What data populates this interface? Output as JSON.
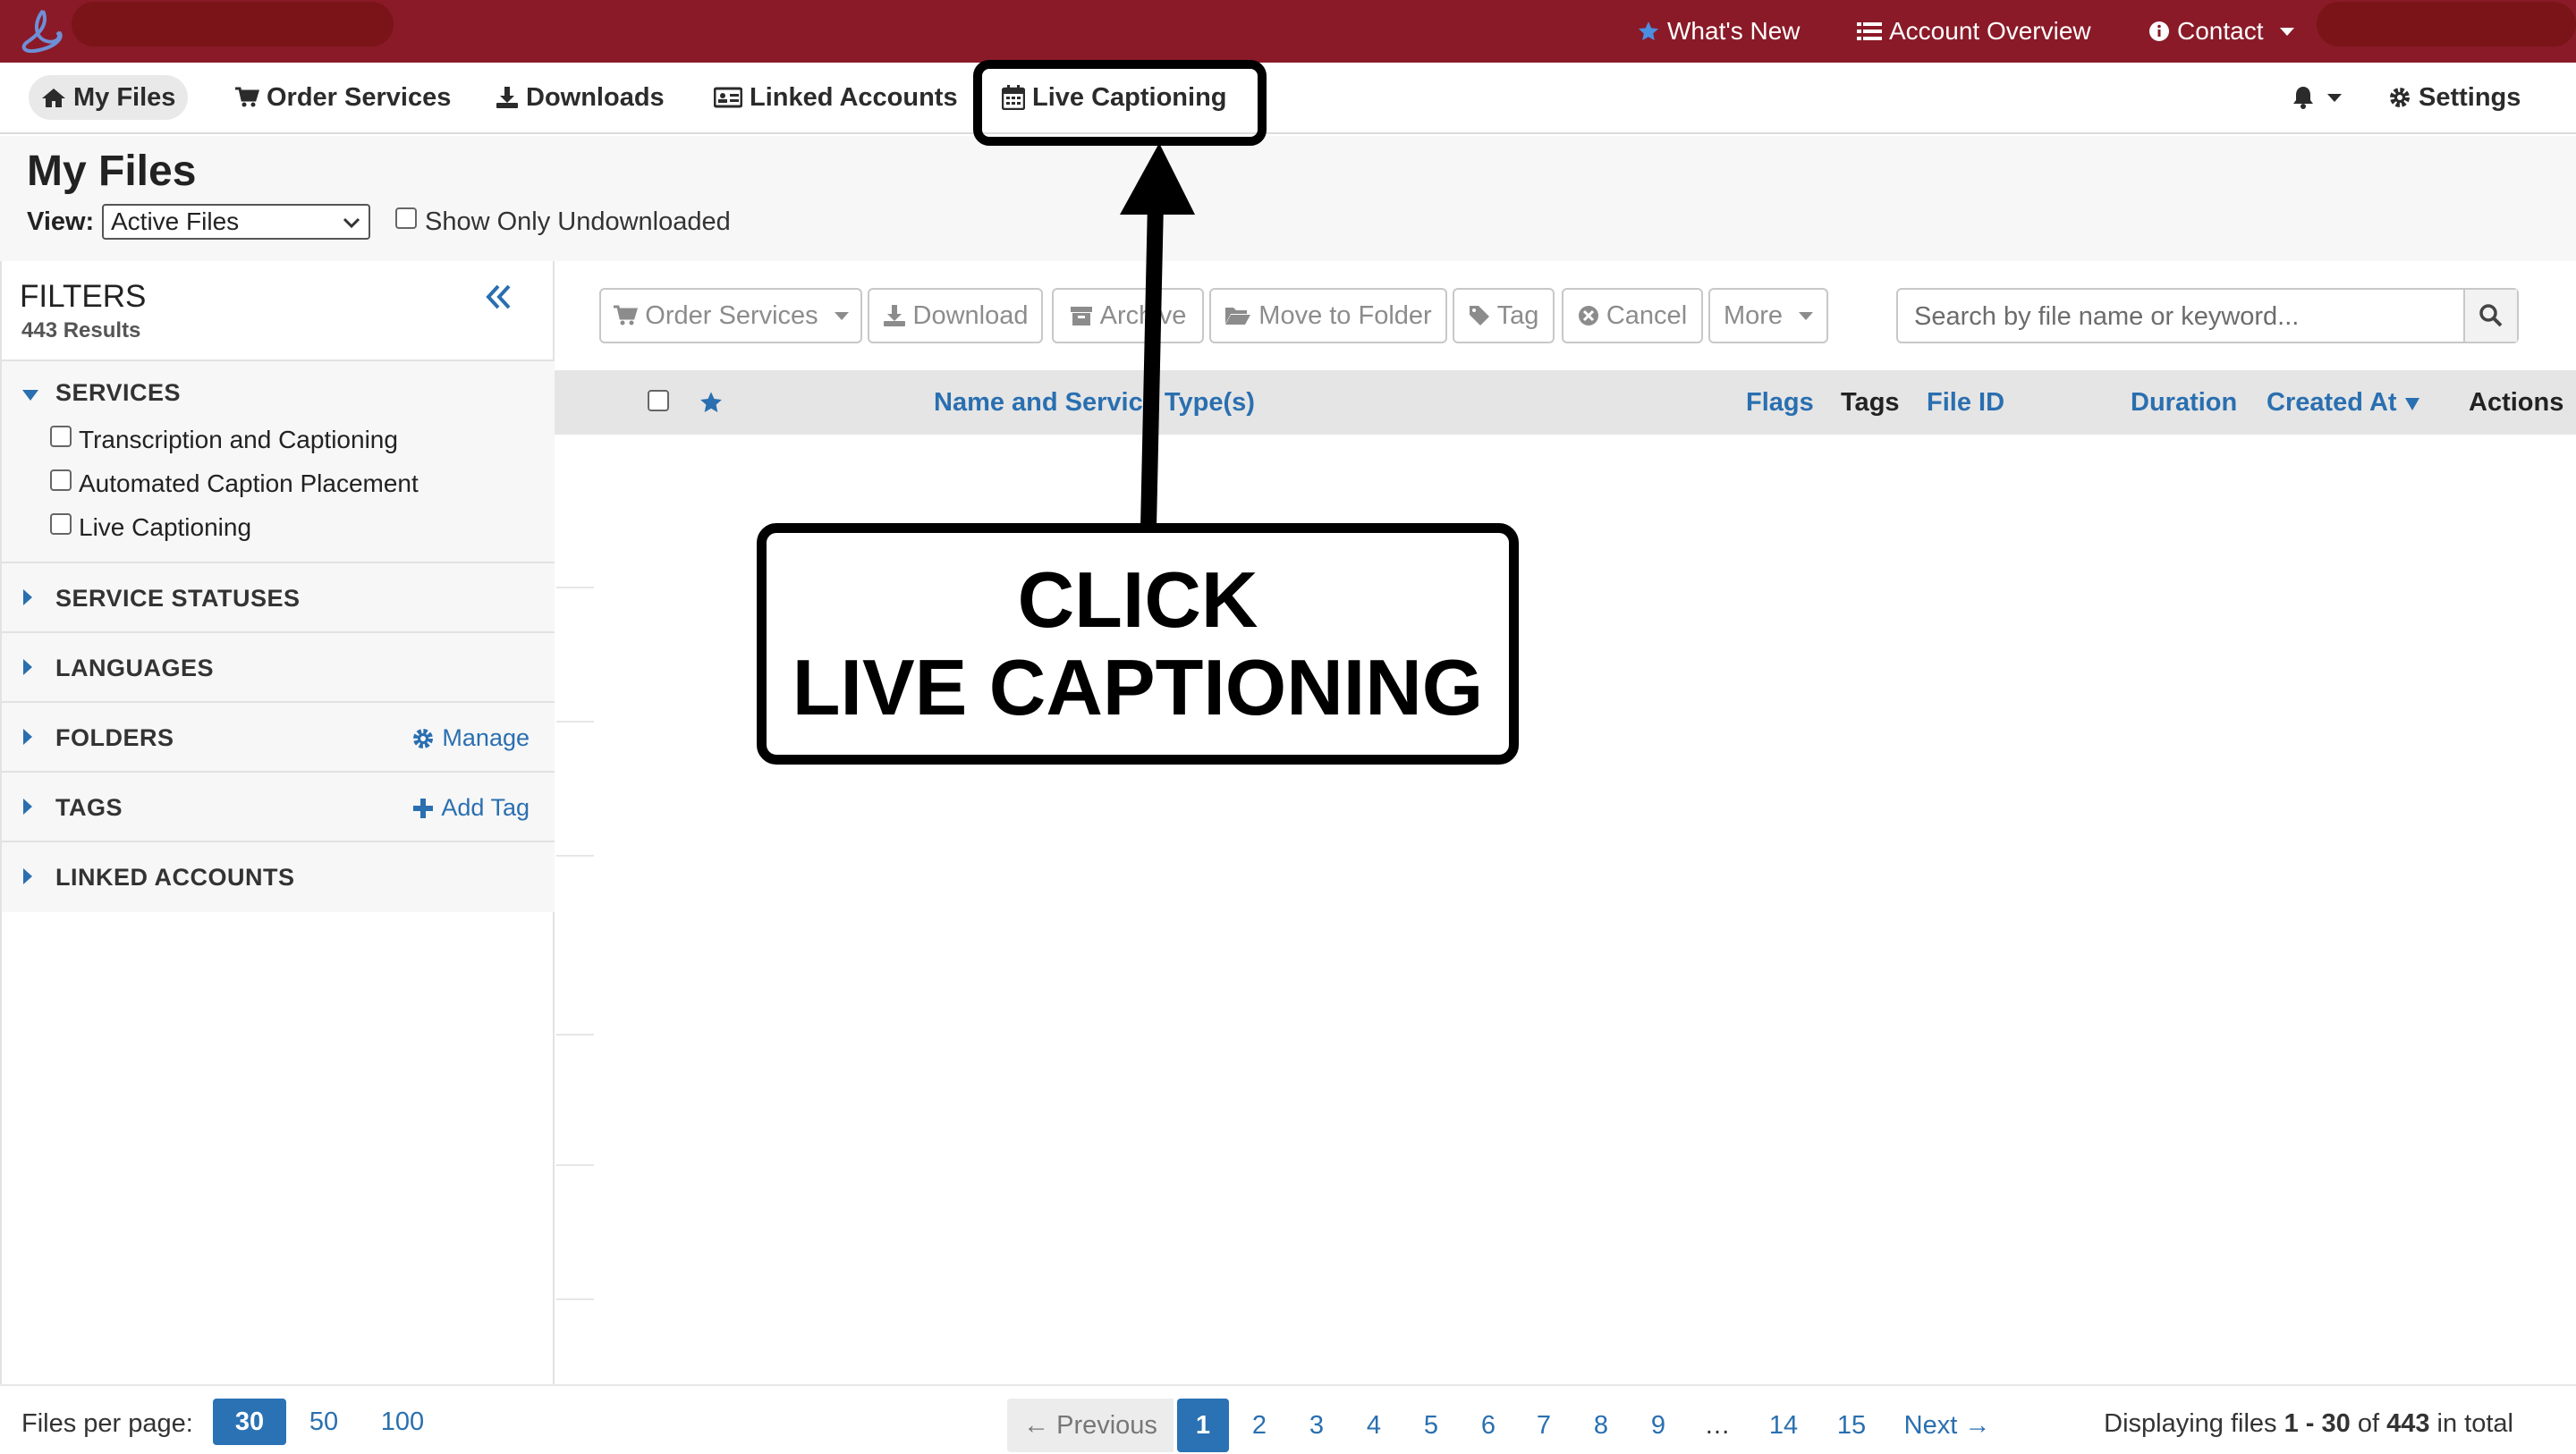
{
  "topbar": {
    "whats_new": "What's New",
    "account_overview": "Account Overview",
    "contact": "Contact"
  },
  "nav": {
    "my_files": "My Files",
    "order_services": "Order Services",
    "downloads": "Downloads",
    "linked_accounts": "Linked Accounts",
    "live_captioning": "Live Captioning",
    "settings": "Settings"
  },
  "page": {
    "title": "My Files",
    "view_label": "View:",
    "view_value": "Active Files",
    "show_only_undownloaded": "Show Only Undownloaded"
  },
  "filters": {
    "title": "FILTERS",
    "results": "443 Results",
    "services": {
      "title": "SERVICES",
      "options": [
        "Transcription and Captioning",
        "Automated Caption Placement",
        "Live Captioning"
      ]
    },
    "service_statuses": "SERVICE STATUSES",
    "languages": "LANGUAGES",
    "folders": "FOLDERS",
    "folders_action": "Manage",
    "tags": "TAGS",
    "tags_action": "Add Tag",
    "linked_accounts": "LINKED ACCOUNTS"
  },
  "toolbar": {
    "order_services": "Order Services",
    "download": "Download",
    "archive": "Archive",
    "move_to_folder": "Move to Folder",
    "tag": "Tag",
    "cancel": "Cancel",
    "more": "More",
    "search_placeholder": "Search by file name or keyword..."
  },
  "table": {
    "headers": {
      "name": "Name and Service Type(s)",
      "flags": "Flags",
      "tags": "Tags",
      "file_id": "File ID",
      "duration": "Duration",
      "created_at": "Created At",
      "actions": "Actions"
    }
  },
  "footer": {
    "files_per_page": "Files per page:",
    "per_page_options": [
      "30",
      "50",
      "100"
    ],
    "per_page_selected": "30",
    "previous": "← Previous",
    "pages": [
      "1",
      "2",
      "3",
      "4",
      "5",
      "6",
      "7",
      "8",
      "9",
      "…",
      "14",
      "15"
    ],
    "next": "Next →",
    "display_prefix": "Displaying files ",
    "display_range": "1 - 30",
    "display_of": " of ",
    "display_total": "443",
    "display_suffix": " in total"
  },
  "annotation": {
    "line1": "CLICK",
    "line2": "LIVE CAPTIONING"
  },
  "colors": {
    "topbar": "#8a1a28",
    "link": "#2a6fb0",
    "active_page": "#2a72b4"
  }
}
